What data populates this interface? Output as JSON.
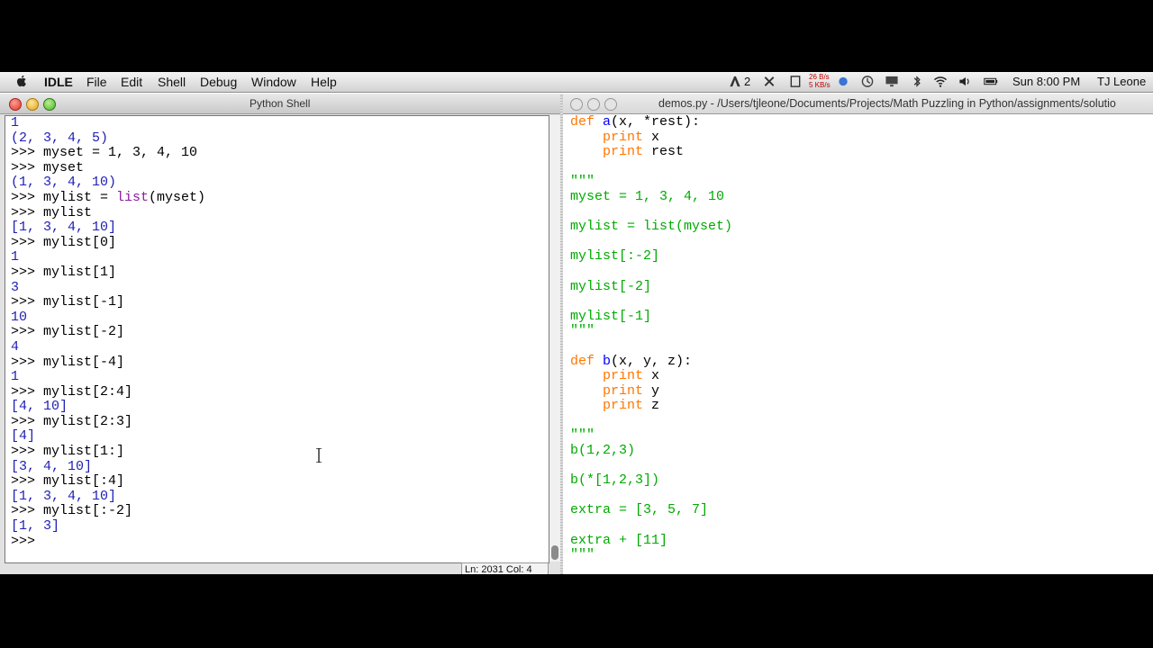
{
  "menubar": {
    "app": "IDLE",
    "menus": [
      "File",
      "Edit",
      "Shell",
      "Debug",
      "Window",
      "Help"
    ],
    "status": {
      "a2": "2",
      "battery": "26 B/s",
      "battery2": "5 KB/s",
      "clock": "Sun 8:00 PM",
      "user": "TJ Leone"
    }
  },
  "shell": {
    "title": "Python Shell",
    "lines": [
      {
        "k": "out",
        "t": "1"
      },
      {
        "k": "out",
        "t": "(2, 3, 4, 5)"
      },
      {
        "k": "in",
        "t": ">>> myset = 1, 3, 4, 10"
      },
      {
        "k": "in",
        "t": ">>> myset"
      },
      {
        "k": "out",
        "t": "(1, 3, 4, 10)"
      },
      {
        "k": "inbi",
        "p": ">>> mylist = ",
        "b": "list",
        "s": "(myset)"
      },
      {
        "k": "in",
        "t": ">>> mylist"
      },
      {
        "k": "out",
        "t": "[1, 3, 4, 10]"
      },
      {
        "k": "in",
        "t": ">>> mylist[0]"
      },
      {
        "k": "out",
        "t": "1"
      },
      {
        "k": "in",
        "t": ">>> mylist[1]"
      },
      {
        "k": "out",
        "t": "3"
      },
      {
        "k": "in",
        "t": ">>> mylist[-1]"
      },
      {
        "k": "out",
        "t": "10"
      },
      {
        "k": "in",
        "t": ">>> mylist[-2]"
      },
      {
        "k": "out",
        "t": "4"
      },
      {
        "k": "in",
        "t": ">>> mylist[-4]"
      },
      {
        "k": "out",
        "t": "1"
      },
      {
        "k": "in",
        "t": ">>> mylist[2:4]"
      },
      {
        "k": "out",
        "t": "[4, 10]"
      },
      {
        "k": "in",
        "t": ">>> mylist[2:3]"
      },
      {
        "k": "out",
        "t": "[4]"
      },
      {
        "k": "in",
        "t": ">>> mylist[1:]"
      },
      {
        "k": "out",
        "t": "[3, 4, 10]"
      },
      {
        "k": "in",
        "t": ">>> mylist[:4]"
      },
      {
        "k": "out",
        "t": "[1, 3, 4, 10]"
      },
      {
        "k": "in",
        "t": ">>> mylist[:-2]"
      },
      {
        "k": "out",
        "t": "[1, 3]"
      },
      {
        "k": "in",
        "t": ">>> "
      }
    ],
    "status": "Ln: 2031 Col: 4"
  },
  "editor": {
    "title": "demos.py - /Users/tjleone/Documents/Projects/Math Puzzling in Python/assignments/solutio",
    "lines": [
      [
        {
          "c": "kw",
          "t": "def "
        },
        {
          "c": "def",
          "t": "a"
        },
        {
          "c": "plain",
          "t": "(x, *rest):"
        }
      ],
      [
        {
          "c": "plain",
          "t": "    "
        },
        {
          "c": "kw",
          "t": "print"
        },
        {
          "c": "plain",
          "t": " x"
        }
      ],
      [
        {
          "c": "plain",
          "t": "    "
        },
        {
          "c": "kw",
          "t": "print"
        },
        {
          "c": "plain",
          "t": " rest"
        }
      ],
      [],
      [
        {
          "c": "str",
          "t": "\"\"\""
        }
      ],
      [
        {
          "c": "str",
          "t": "myset = 1, 3, 4, 10"
        }
      ],
      [],
      [
        {
          "c": "str",
          "t": "mylist = list(myset)"
        }
      ],
      [],
      [
        {
          "c": "str",
          "t": "mylist[:-2]"
        }
      ],
      [],
      [
        {
          "c": "str",
          "t": "mylist[-2]"
        }
      ],
      [],
      [
        {
          "c": "str",
          "t": "mylist[-1]"
        }
      ],
      [
        {
          "c": "str",
          "t": "\"\"\""
        }
      ],
      [],
      [
        {
          "c": "kw",
          "t": "def "
        },
        {
          "c": "def",
          "t": "b"
        },
        {
          "c": "plain",
          "t": "(x, y, z):"
        }
      ],
      [
        {
          "c": "plain",
          "t": "    "
        },
        {
          "c": "kw",
          "t": "print"
        },
        {
          "c": "plain",
          "t": " x"
        }
      ],
      [
        {
          "c": "plain",
          "t": "    "
        },
        {
          "c": "kw",
          "t": "print"
        },
        {
          "c": "plain",
          "t": " y"
        }
      ],
      [
        {
          "c": "plain",
          "t": "    "
        },
        {
          "c": "kw",
          "t": "print"
        },
        {
          "c": "plain",
          "t": " z"
        }
      ],
      [],
      [
        {
          "c": "str",
          "t": "\"\"\""
        }
      ],
      [
        {
          "c": "str",
          "t": "b(1,2,3)"
        }
      ],
      [],
      [
        {
          "c": "str",
          "t": "b(*[1,2,3])"
        }
      ],
      [],
      [
        {
          "c": "str",
          "t": "extra = [3, 5, 7]"
        }
      ],
      [],
      [
        {
          "c": "str",
          "t": "extra + [11]"
        }
      ],
      [
        {
          "c": "str",
          "t": "\"\"\""
        }
      ]
    ]
  }
}
